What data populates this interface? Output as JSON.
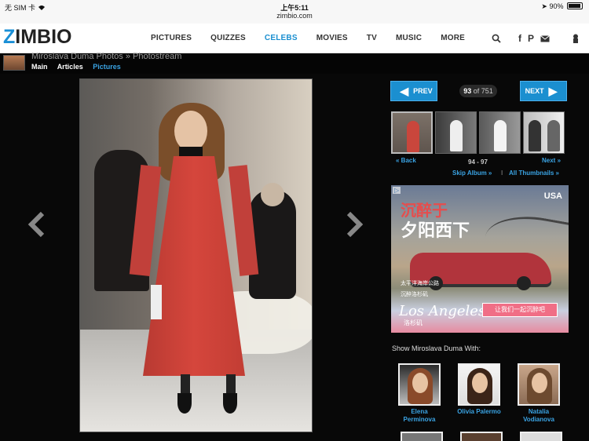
{
  "status_bar": {
    "carrier": "无 SIM 卡",
    "time": "上午5:11",
    "url": "zimbio.com",
    "battery": "90%"
  },
  "nav": {
    "logo": "ZIMBIO",
    "links": [
      {
        "label": "PICTURES",
        "active": false
      },
      {
        "label": "QUIZZES",
        "active": false
      },
      {
        "label": "CELEBS",
        "active": true
      },
      {
        "label": "MOVIES",
        "active": false
      },
      {
        "label": "TV",
        "active": false
      },
      {
        "label": "MUSIC",
        "active": false
      },
      {
        "label": "MORE",
        "active": false
      }
    ],
    "icons": [
      "search-icon",
      "facebook-icon",
      "pinterest-icon",
      "mail-icon",
      "user-icon"
    ],
    "accent": "#1b8fd0"
  },
  "breadcrumb": {
    "title": "Miroslava Duma Photos  »  Photostream",
    "tabs": [
      "Main",
      "Articles",
      "Pictures"
    ],
    "active_tab": "Pictures"
  },
  "gallery": {
    "prev_label": "PREV",
    "next_label": "NEXT",
    "current": "93",
    "of_label": "of 751",
    "back_label": "« Back",
    "range_label": "94 - 97",
    "next_link_label": "Next »",
    "skip_album": "Skip Album »",
    "separator": "I",
    "all_thumbnails": "All Thumbnails »"
  },
  "ad": {
    "adchoices": "▷",
    "usa": "USA",
    "headline_1": "沉醉于",
    "headline_2": "夕阳西下",
    "line_1": "太平洋海岸公路",
    "line_2": "沉醉洛杉矶",
    "brand": "Los Angeles",
    "brand_cn": "洛杉矶",
    "cta": "让我们一起沉醉吧"
  },
  "related": {
    "heading": "Show Miroslava Duma With:",
    "people": [
      {
        "name": "Elena Perminova"
      },
      {
        "name": "Olivia Palermo"
      },
      {
        "name": "Natalia Vodianova"
      }
    ]
  }
}
